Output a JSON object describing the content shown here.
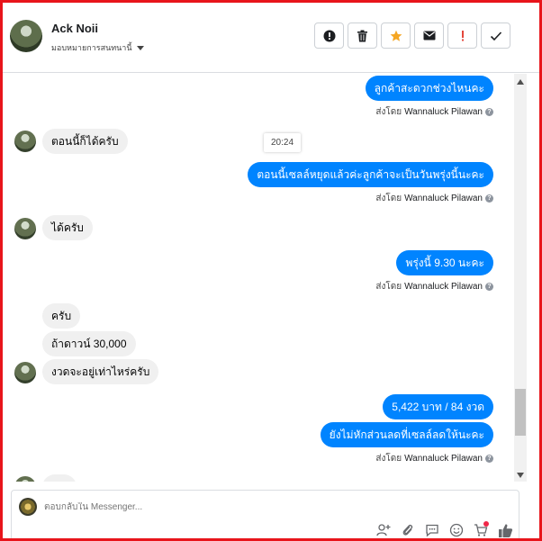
{
  "header": {
    "name": "Ack Noii",
    "subtitle": "มอบหมายการสนทนานี้",
    "actions": [
      {
        "name": "report-spam-button",
        "icon": "exclamation-circle-icon"
      },
      {
        "name": "delete-button",
        "icon": "trash-icon"
      },
      {
        "name": "star-button",
        "icon": "star-icon"
      },
      {
        "name": "mark-unread-button",
        "icon": "envelope-icon"
      },
      {
        "name": "follow-up-button",
        "icon": "exclamation-icon"
      },
      {
        "name": "mark-done-button",
        "icon": "checkmark-icon"
      }
    ]
  },
  "thread": {
    "timestamp": "20:24",
    "sent_by_prefix": "ส่งโดย",
    "sent_by_name": "Wannaluck Pilawan",
    "messages": {
      "m1": "ลูกค้าสะดวกช่วงไหนคะ",
      "m2": "ตอนนี้ก็ได้ครับ",
      "m3": "ตอนนี้เซลล์หยุดแล้วค่ะลูกค้าจะเป็นวันพรุ่งนี้นะคะ",
      "m4": "ได้ครับ",
      "m5": "พรุ่งนี้ 9.30  นะคะ",
      "m6": "ครับ",
      "m7": "ถ้าดาวน์ 30,000",
      "m8": "งวดจะอยู่เท่าไหร่ครับ",
      "m9": "5,422 บาท /     84 งวด",
      "m10": "ยังไม่หักส่วนลดที่เซลล์ลดให้นะคะ"
    }
  },
  "composer": {
    "placeholder": "ตอบกลับใน Messenger...",
    "tools": [
      "add-person-icon",
      "attachment-icon",
      "saved-replies-icon",
      "emoji-icon",
      "cart-icon",
      "like-icon"
    ]
  },
  "colors": {
    "outgoing_bubble": "#0084ff",
    "incoming_bubble": "#f0f0f0",
    "frame_border": "#e8141b",
    "star": "#f5a623",
    "alert": "#e4463b"
  }
}
